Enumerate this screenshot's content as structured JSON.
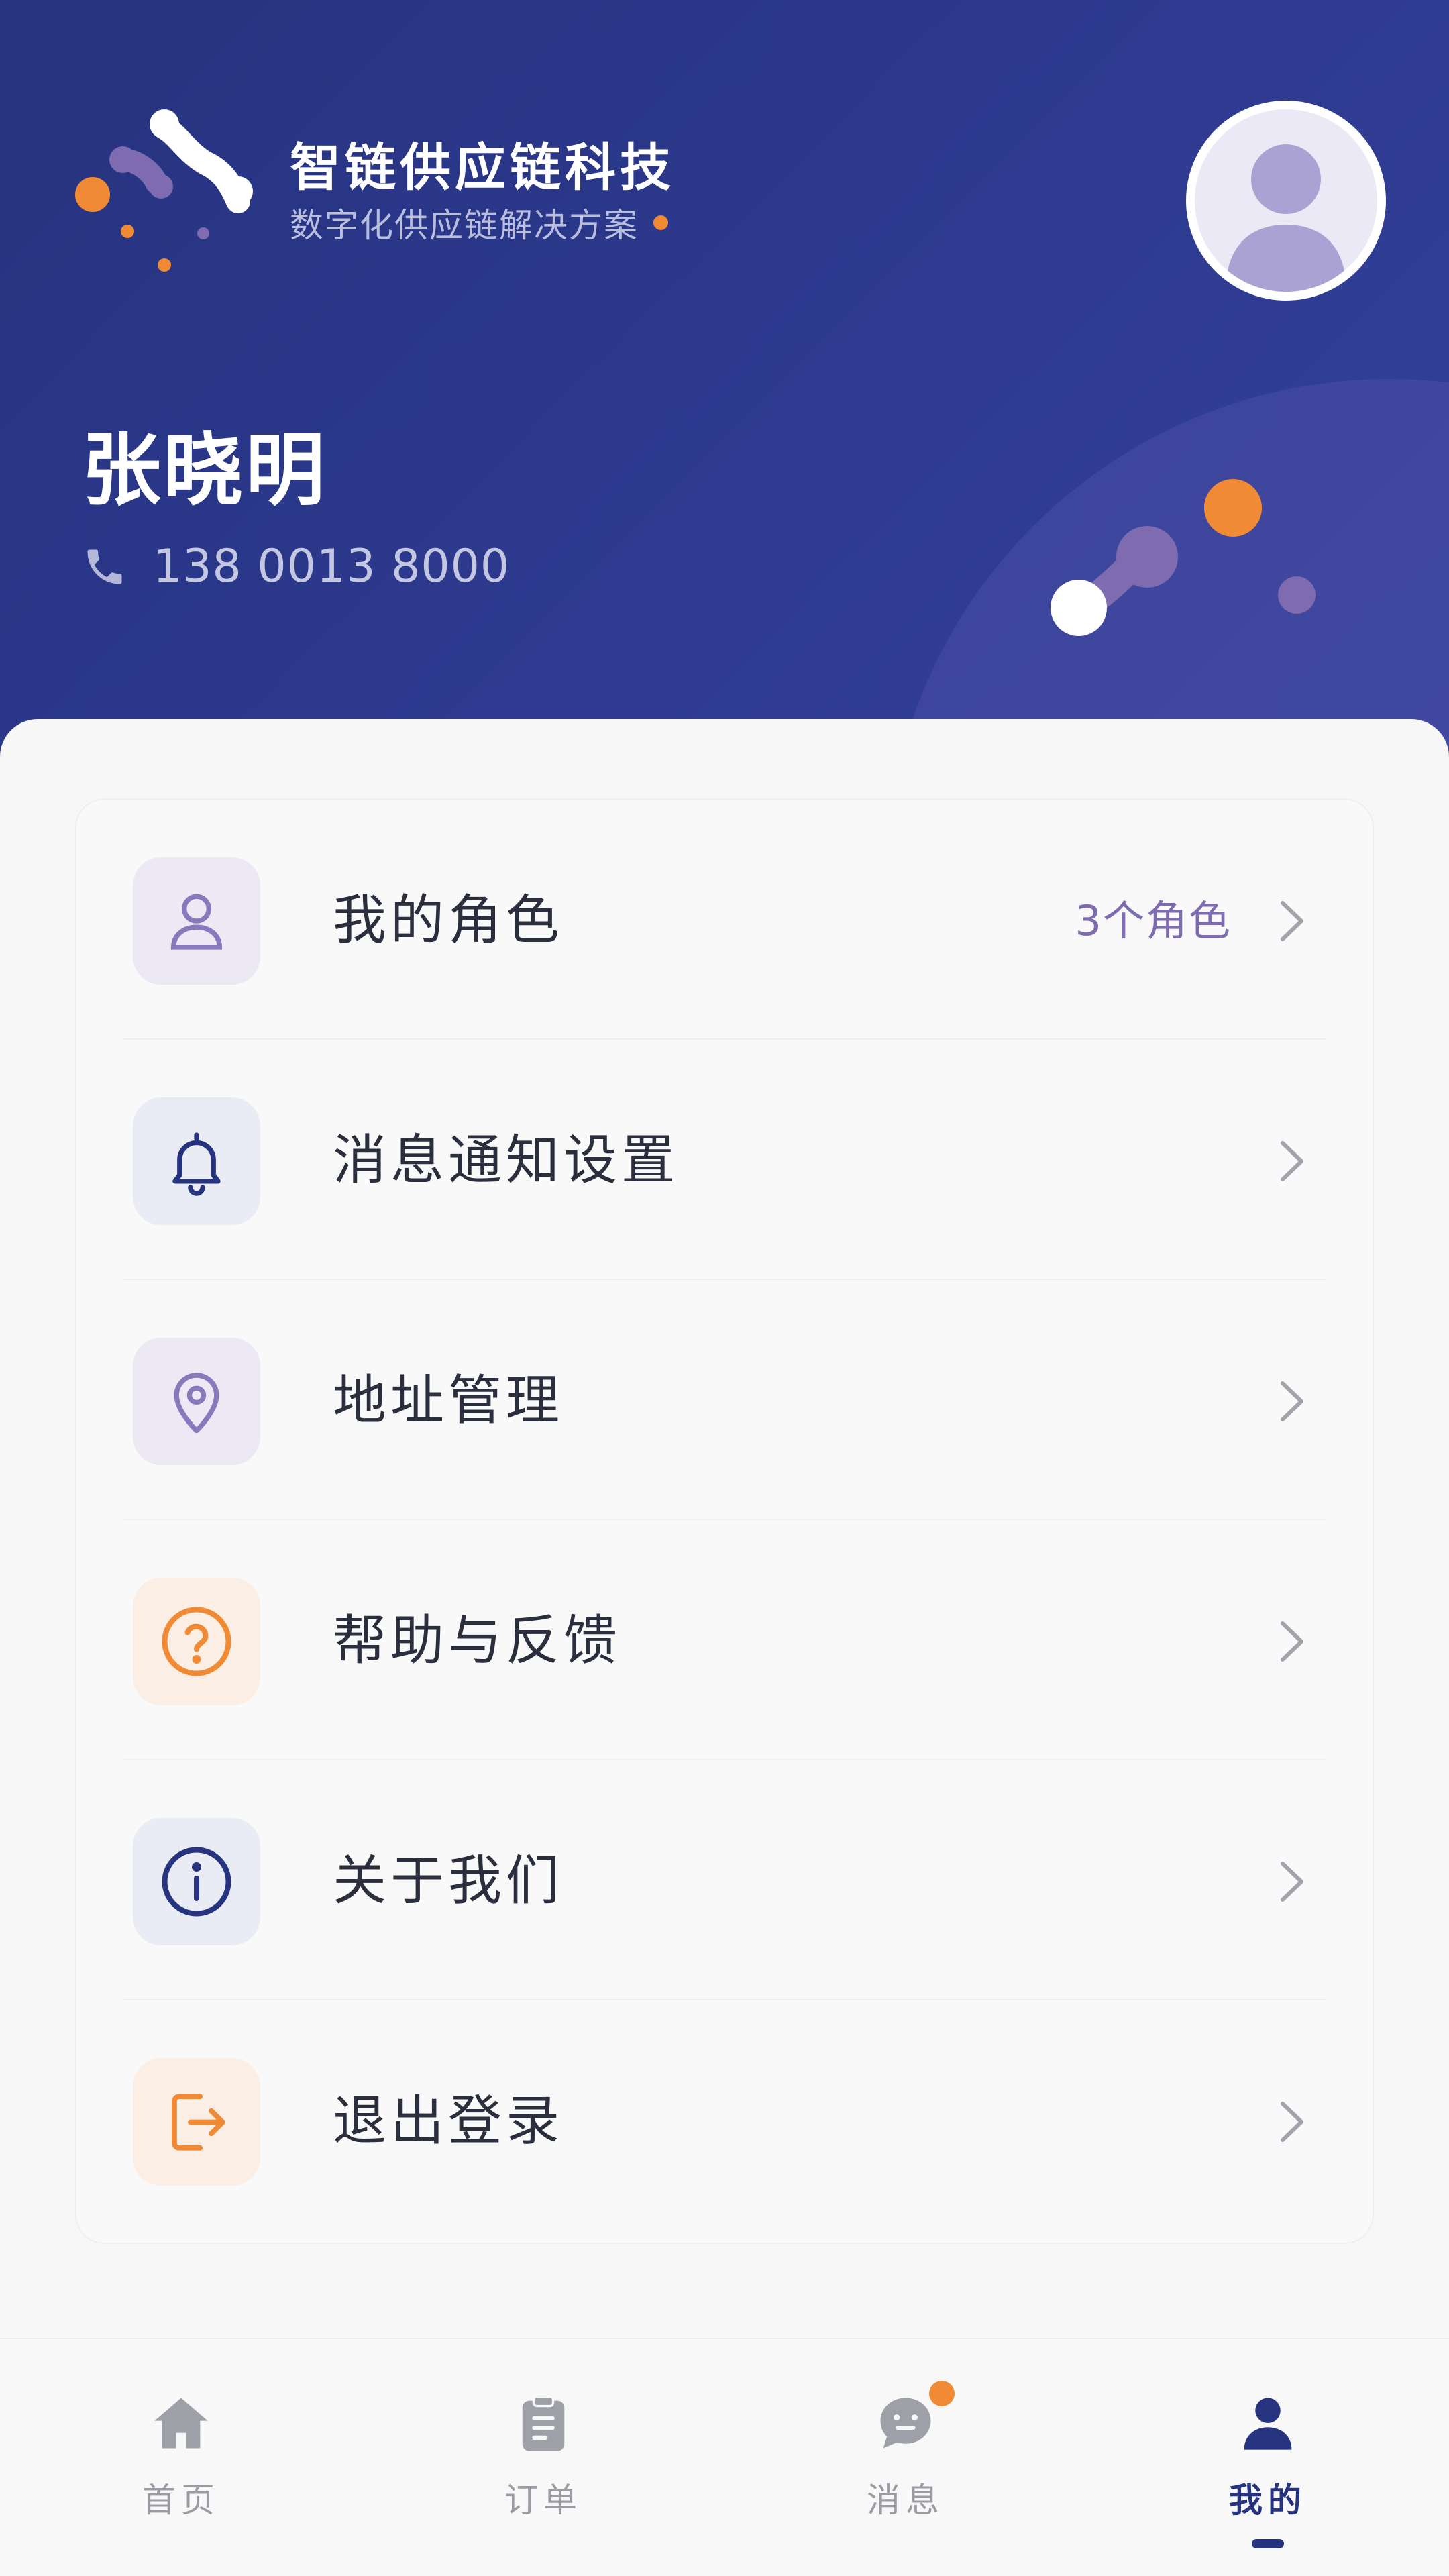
{
  "brand": {
    "name": "智链供应链科技",
    "tagline": "数字化供应链解决方案"
  },
  "profile": {
    "name": "张晓明",
    "phone": "138 0013 8000",
    "avatar_icon": "user-avatar-icon"
  },
  "menu": [
    {
      "label": "我的角色",
      "badge": "3个角色",
      "icon": "user-icon",
      "tint": "#ece9f5"
    },
    {
      "label": "消息通知设置",
      "badge": "",
      "icon": "bell-icon",
      "tint": "#e9ecf5"
    },
    {
      "label": "地址管理",
      "badge": "",
      "icon": "location-pin-icon",
      "tint": "#ece9f5"
    },
    {
      "label": "帮助与反馈",
      "badge": "",
      "icon": "help-circle-icon",
      "tint": "#fbeee4"
    },
    {
      "label": "关于我们",
      "badge": "",
      "icon": "info-circle-icon",
      "tint": "#e9ecf5"
    },
    {
      "label": "退出登录",
      "badge": "",
      "icon": "logout-icon",
      "tint": "#fbeee4"
    }
  ],
  "tabbar": [
    {
      "label": "首页",
      "icon": "home-icon",
      "active": false
    },
    {
      "label": "订单",
      "icon": "clipboard-icon",
      "active": false
    },
    {
      "label": "消息",
      "icon": "chat-bubble-icon",
      "active": false,
      "has_unread_dot": true
    },
    {
      "label": "我的",
      "icon": "person-icon",
      "active": true
    }
  ],
  "colors": {
    "header": "#2d3a8f",
    "accent_orange": "#f08a34",
    "accent_purple": "#7e6bb0",
    "active_tab": "#26337f"
  }
}
